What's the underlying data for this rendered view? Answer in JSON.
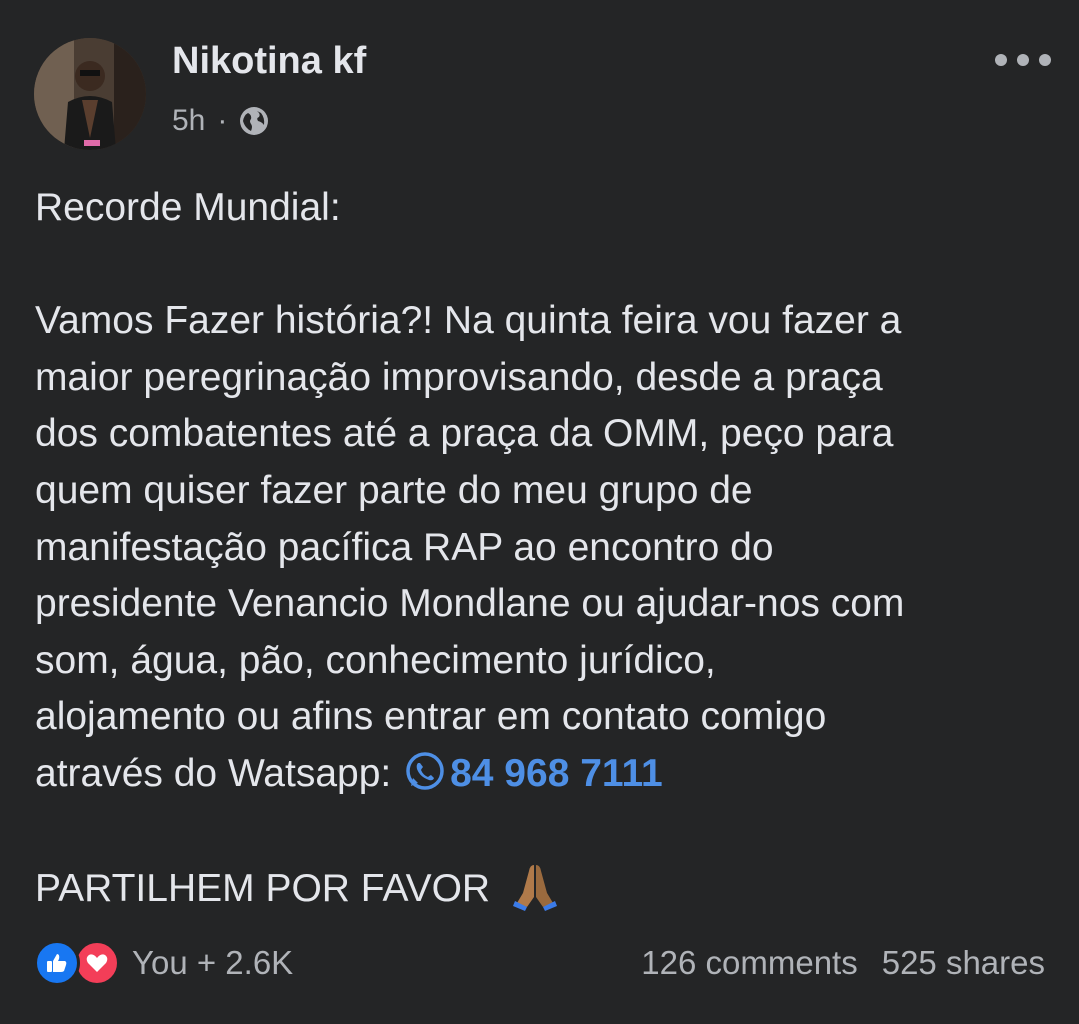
{
  "post": {
    "author": "Nikotina kf",
    "time": "5h",
    "separator": "·",
    "privacy_icon": "globe-icon",
    "more_icon": "more-options-icon",
    "body": {
      "title": "Recorde Mundial:",
      "lines": [
        "Vamos Fazer história?! Na quinta feira vou fazer a",
        "maior peregrinação improvisando, desde a praça",
        "dos combatentes até a praça da OMM, peço para",
        "quem quiser fazer parte do meu grupo de",
        "manifestação pacífica RAP ao encontro do",
        "presidente Venancio Mondlane ou ajudar-nos com",
        "som, água, pão, conhecimento jurídico,",
        "alojamento ou afins entrar em contato comigo"
      ],
      "last_line_prefix": "através do Watsapp:",
      "phone_icon": "whatsapp-icon",
      "phone": "84 968 7111",
      "closing": "PARTILHEM POR FAVOR",
      "closing_emoji": "folded-hands-icon"
    },
    "reactions": {
      "icons": [
        "like-icon",
        "love-icon"
      ],
      "count": "You + 2.6K"
    },
    "stats": {
      "comments": "126 comments",
      "shares": "525 shares"
    }
  },
  "colors": {
    "background": "#242526",
    "text": "#e4e6eb",
    "secondary": "#b0b3b8",
    "link": "#4e8fe5",
    "like": "#1877f2",
    "love": "#f33e58"
  }
}
